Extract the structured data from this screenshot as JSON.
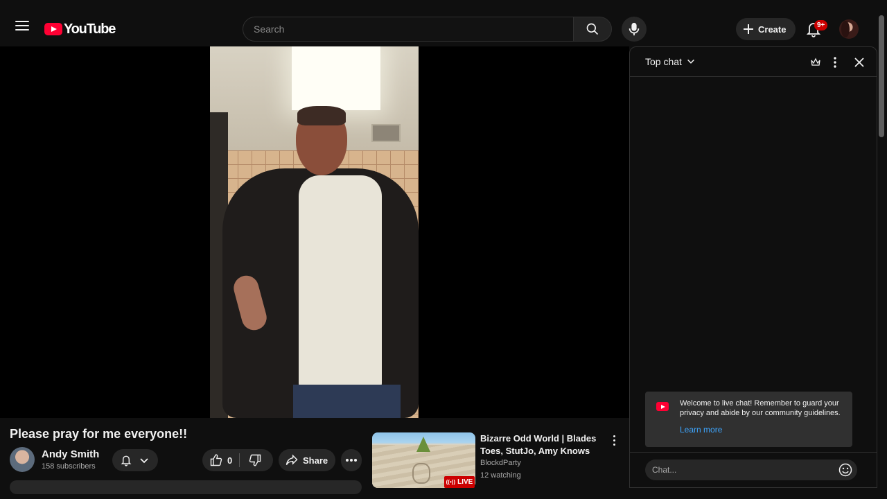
{
  "header": {
    "logo_text": "YouTube",
    "search_placeholder": "Search",
    "create_label": "Create",
    "notifications_badge": "9+"
  },
  "video": {
    "title": "Please pray for me everyone!!",
    "channel_name": "Andy Smith",
    "subscribers": "158 subscribers",
    "like_count": "0",
    "share_label": "Share"
  },
  "recommendation": {
    "title": "Bizarre Odd World | Blades Toes, StutJo, Amy Knows",
    "channel": "BlockdParty",
    "watching": "12 watching",
    "live_label": "LIVE"
  },
  "chat": {
    "title": "Top chat",
    "welcome_message": "Welcome to live chat! Remember to guard your privacy and abide by our community guidelines.",
    "learn_more": "Learn more",
    "input_placeholder": "Chat..."
  },
  "colors": {
    "brand_red": "#ff0033",
    "link_blue": "#3ea6ff",
    "background": "#0f0f0f",
    "pill_bg": "#272727"
  }
}
